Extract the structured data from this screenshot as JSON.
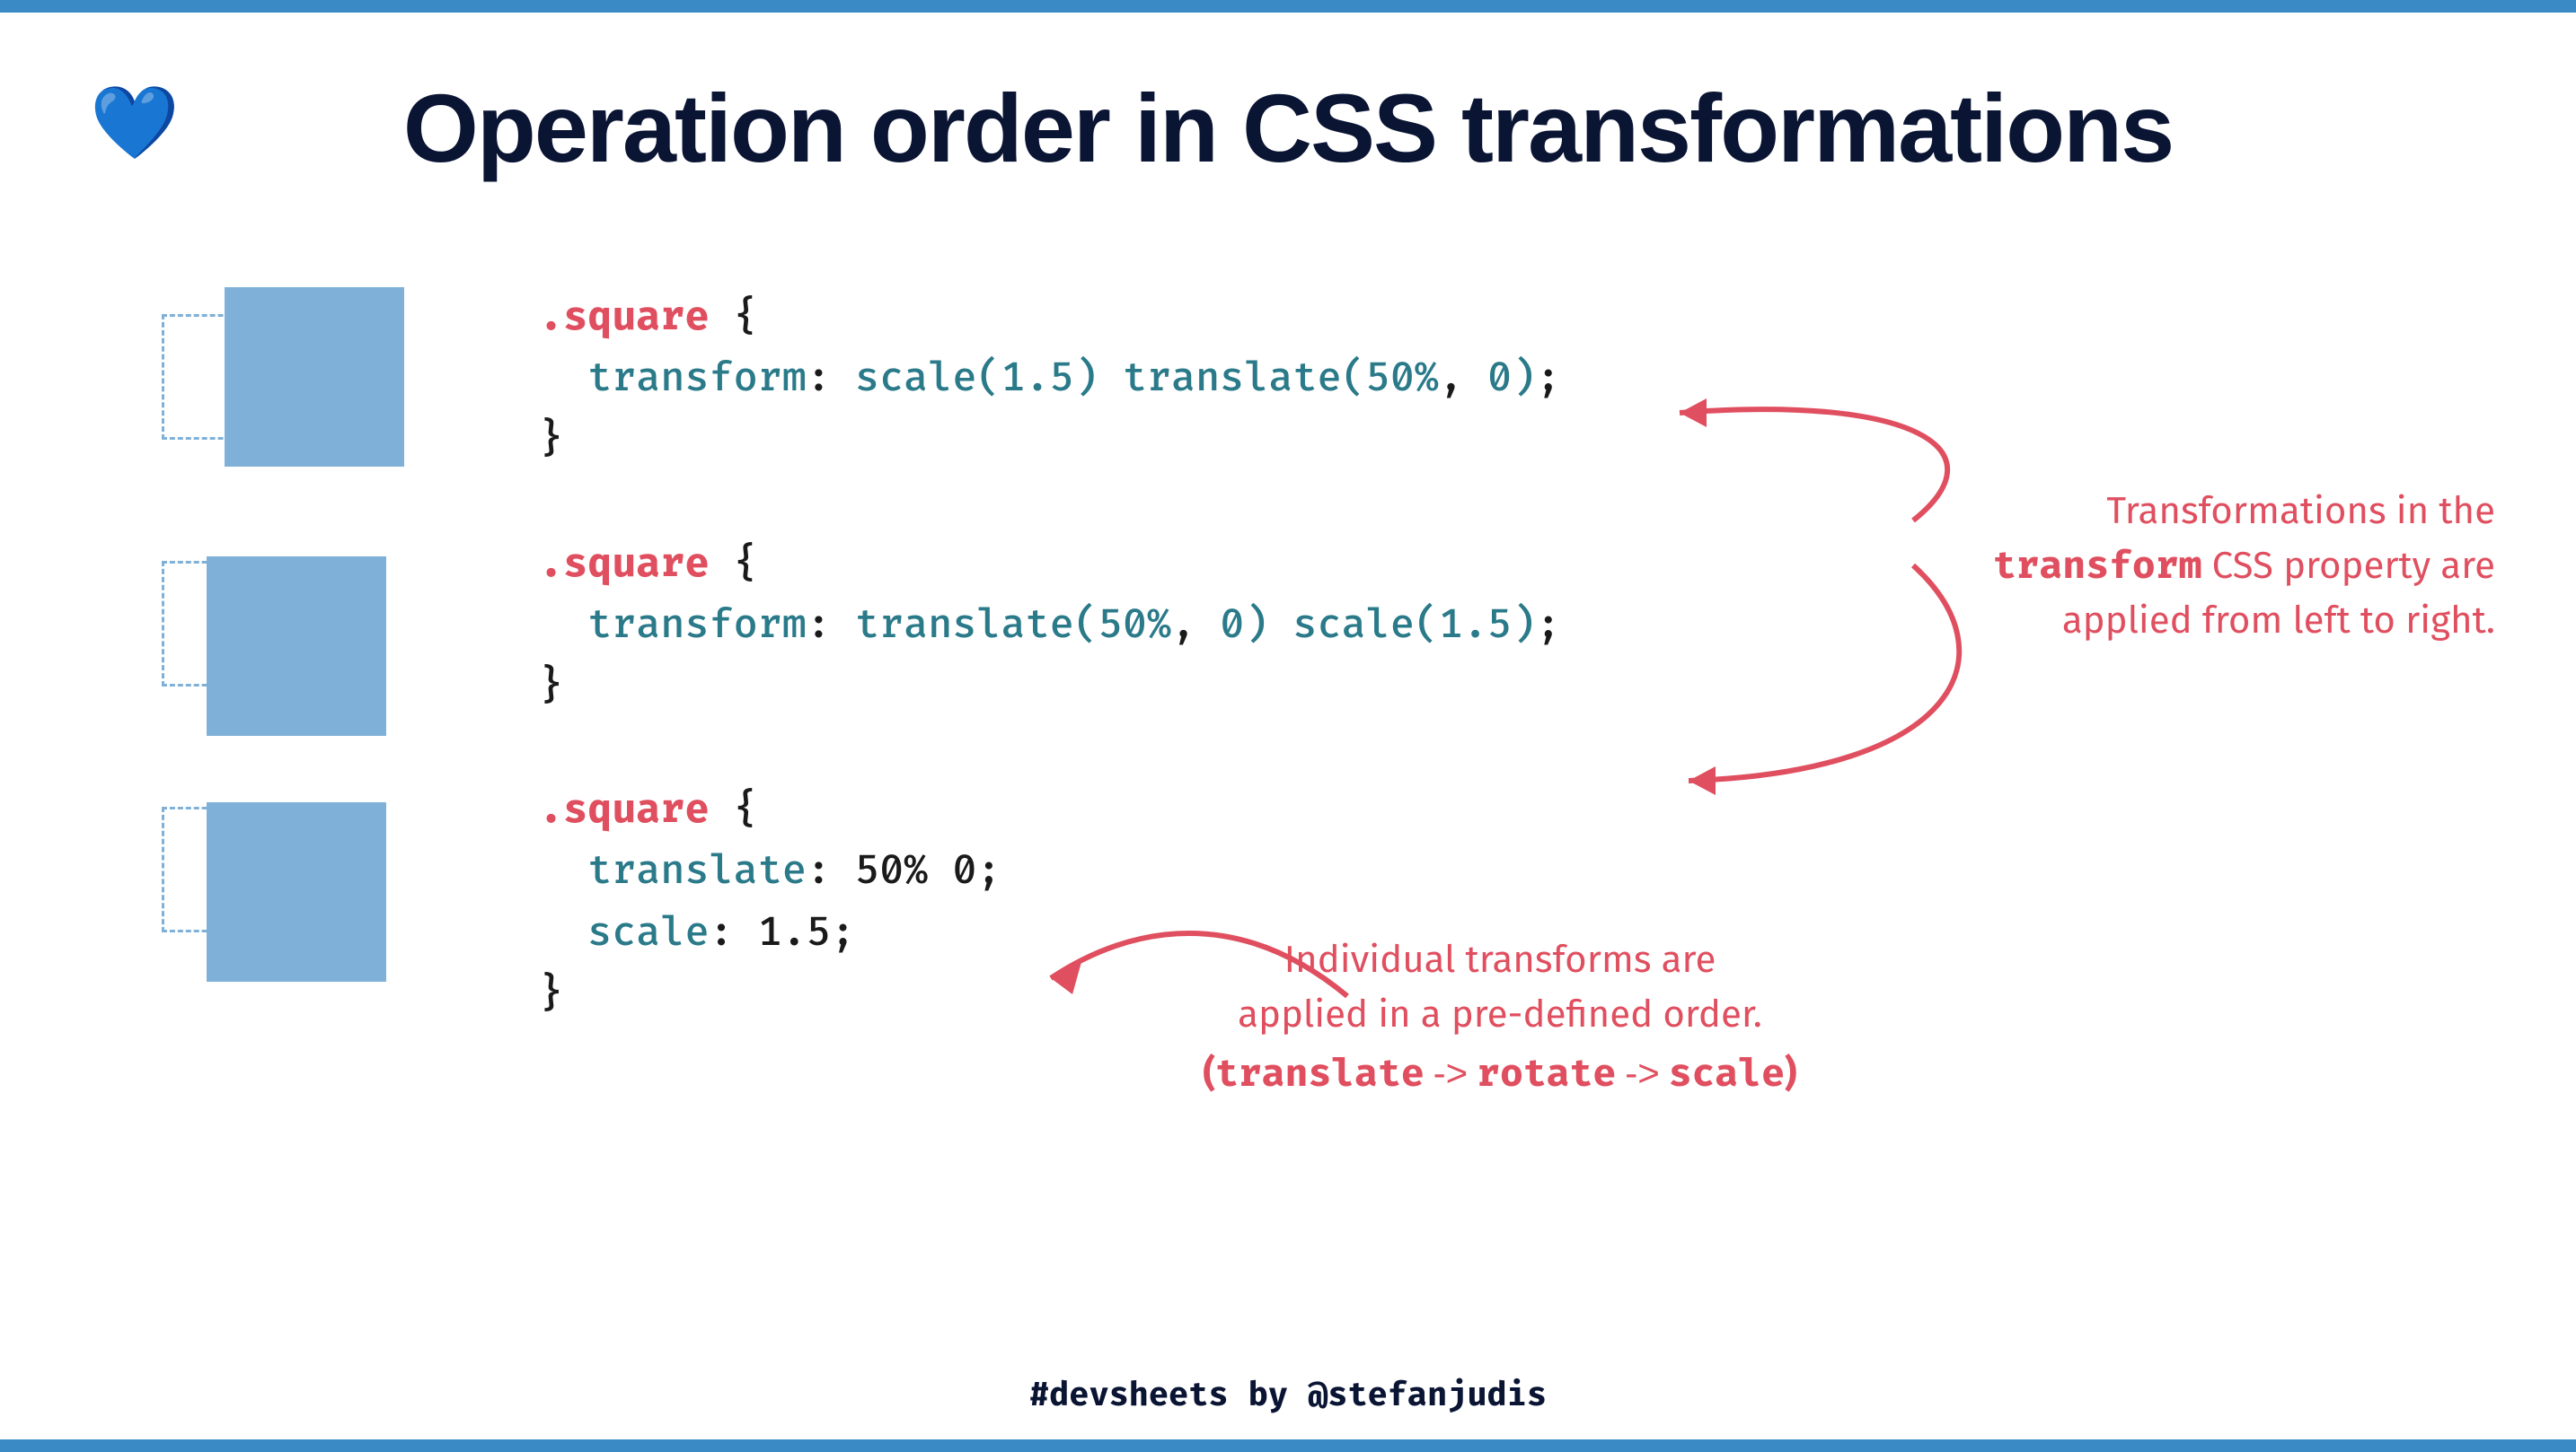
{
  "title": "Operation order in CSS transformations",
  "heart_icon": "💙",
  "examples": [
    {
      "selector": ".square",
      "lines": [
        {
          "prop": "transform",
          "raw_html": "<span class='fn'>scale</span><span class='paren'>(</span><span class='num'>1.5</span><span class='paren'>)</span> <span class='fn'>translate</span><span class='paren'>(</span><span class='num'>50%</span><span class='punct'>,</span> <span class='num'>0</span><span class='paren'>)</span>"
        }
      ]
    },
    {
      "selector": ".square",
      "lines": [
        {
          "prop": "transform",
          "raw_html": "<span class='fn'>translate</span><span class='paren'>(</span><span class='num'>50%</span><span class='punct'>,</span> <span class='num'>0</span><span class='paren'>)</span> <span class='fn'>scale</span><span class='paren'>(</span><span class='num'>1.5</span><span class='paren'>)</span>"
        }
      ]
    },
    {
      "selector": ".square",
      "lines": [
        {
          "prop": "translate",
          "raw_html": "<span class='val'>50% 0</span>"
        },
        {
          "prop": "scale",
          "raw_html": "<span class='val'>1.5</span>"
        }
      ]
    }
  ],
  "annotation_right": {
    "line1": "Transformations in the",
    "keyword": "transform",
    "line2_rest": " CSS property are",
    "line3": "applied from left to right."
  },
  "annotation_bottom": {
    "line1": "Individual transforms are",
    "line2": "applied in a pre-defined order.",
    "order_open": "(",
    "order_a": "translate",
    "order_b": "rotate",
    "order_c": "scale",
    "order_close": ")"
  },
  "footer": {
    "hashtag": "#devsheets",
    "by": " by ",
    "handle": "@stefanjudis"
  },
  "colors": {
    "accent_blue": "#3a8ac6",
    "box_blue": "#7fb1d8",
    "red": "#e04f5f",
    "dark": "#0a1433"
  }
}
